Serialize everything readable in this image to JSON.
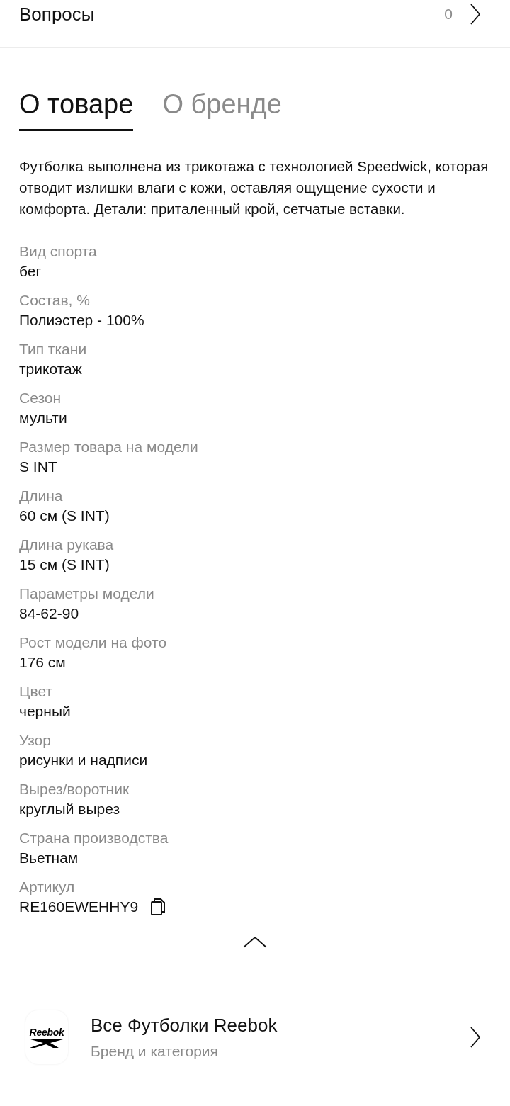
{
  "questions": {
    "label": "Вопросы",
    "count": "0"
  },
  "tabs": [
    {
      "label": "О товаре",
      "selected": true
    },
    {
      "label": "О бренде",
      "selected": false
    }
  ],
  "description": "Футболка выполнена из трикотажа с технологией Speedwick, которая отводит излишки влаги с кожи, оставляя ощущение сухости и комфорта. Детали: приталенный крой, сетчатые вставки.",
  "specs": [
    {
      "kind": "text",
      "label": "Вид спорта",
      "value": "бег"
    },
    {
      "kind": "text",
      "label": "Состав, %",
      "value": "Полиэстер - 100%"
    },
    {
      "kind": "text",
      "label": "Тип ткани",
      "value": "трикотаж"
    },
    {
      "kind": "text",
      "label": "Сезон",
      "value": "мульти"
    },
    {
      "kind": "text",
      "label": "Размер товара на модели",
      "value": "S INT"
    },
    {
      "kind": "text",
      "label": "Длина",
      "value": "60 см (S INT)"
    },
    {
      "kind": "text",
      "label": "Длина рукава",
      "value": "15 см (S INT)"
    },
    {
      "kind": "text",
      "label": "Параметры модели",
      "value": "84-62-90"
    },
    {
      "kind": "text",
      "label": "Рост модели на фото",
      "value": "176 см"
    },
    {
      "kind": "text",
      "label": "Цвет",
      "value": "черный"
    },
    {
      "kind": "text",
      "label": "Узор",
      "value": "рисунки и надписи"
    },
    {
      "kind": "text",
      "label": "Вырез/воротник",
      "value": "круглый вырез"
    },
    {
      "kind": "text",
      "label": "Страна производства",
      "value": "Вьетнам"
    },
    {
      "kind": "copyable",
      "label": "Артикул",
      "value": "RE160EWEHHY9"
    }
  ],
  "brand_link": {
    "logo_text": "Reebok",
    "title": "Все Футболки Reebok",
    "subtitle": "Бренд и категория"
  }
}
